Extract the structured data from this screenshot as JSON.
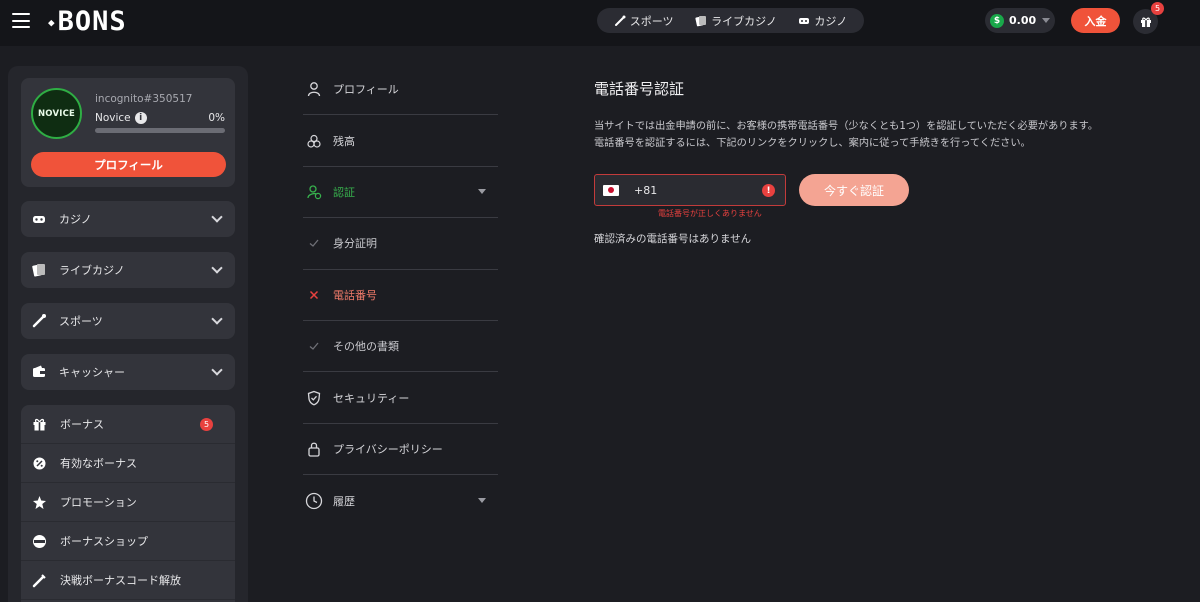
{
  "header": {
    "logo": "BONS",
    "nav": [
      {
        "label": "スポーツ",
        "icon": "sports-icon"
      },
      {
        "label": "ライブカジノ",
        "icon": "live-casino-icon"
      },
      {
        "label": "カジノ",
        "icon": "casino-icon"
      }
    ],
    "balance": "0.00",
    "currency_icon": "dollar-coin-icon",
    "deposit_label": "入金",
    "gift_badge": "5"
  },
  "sidebar": {
    "username": "incognito#350517",
    "rank": "Novice",
    "rank_progress": "0%",
    "rank_progress_value": 0,
    "avatar_text": "NOVICE",
    "profile_button": "プロフィール",
    "sections": [
      {
        "label": "カジノ",
        "icon": "casino-icon"
      },
      {
        "label": "ライブカジノ",
        "icon": "live-casino-icon"
      },
      {
        "label": "スポーツ",
        "icon": "sports-icon"
      },
      {
        "label": "キャッシャー",
        "icon": "wallet-icon"
      }
    ],
    "bonus_items": [
      {
        "label": "ボーナス",
        "icon": "gift-icon",
        "badge": "5"
      },
      {
        "label": "有効なボーナス",
        "icon": "active-bonus-icon"
      },
      {
        "label": "プロモーション",
        "icon": "promotion-icon"
      },
      {
        "label": "ボーナスショップ",
        "icon": "bonus-shop-icon"
      },
      {
        "label": "決戦ボーナスコード解放",
        "icon": "code-icon"
      }
    ]
  },
  "menu": {
    "items": [
      {
        "label": "プロフィール",
        "icon": "user-icon",
        "state": "normal"
      },
      {
        "label": "残高",
        "icon": "coins-icon",
        "state": "normal"
      },
      {
        "label": "認証",
        "icon": "verification-icon",
        "state": "active",
        "expandable": true
      },
      {
        "label": "身分証明",
        "icon": "check-icon",
        "state": "sub"
      },
      {
        "label": "電話番号",
        "icon": "cross-icon",
        "state": "error"
      },
      {
        "label": "その他の書類",
        "icon": "check-icon",
        "state": "sub"
      },
      {
        "label": "セキュリティー",
        "icon": "shield-icon",
        "state": "normal"
      },
      {
        "label": "プライバシーポリシー",
        "icon": "lock-icon",
        "state": "normal"
      },
      {
        "label": "履歴",
        "icon": "history-icon",
        "state": "normal",
        "expandable": true
      }
    ]
  },
  "main": {
    "title": "電話番号認証",
    "description_line1": "当サイトでは出金申請の前に、お客様の携帯電話番号（少なくとも1つ）を認証していただく必要があります。",
    "description_line2": "電話番号を認証するには、下記のリンクをクリックし、案内に従って手続きを行ってください。",
    "phone_value": "+81",
    "error_message": "電話番号が正しくありません",
    "verify_button": "今すぐ認証",
    "no_verified": "確認済みの電話番号はありません"
  },
  "colors": {
    "accent": "#f0533a",
    "success": "#37b24d",
    "error": "#e8413f",
    "background": "#1c1d22",
    "panel": "#33343b"
  }
}
